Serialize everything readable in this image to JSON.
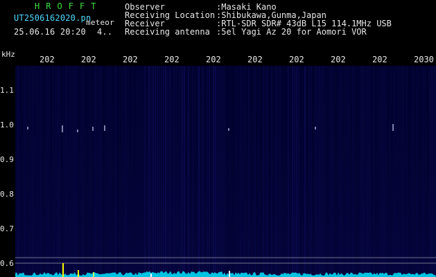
{
  "app": {
    "title": "HROFFT",
    "file_name": "UT2506162020.pn",
    "meteor_label": "meteor",
    "datetime": "25.06.16 20:20",
    "count": "4.."
  },
  "info": [
    {
      "key": "Observer",
      "value": ":Masaki Kano"
    },
    {
      "key": "Receiving Location",
      "value": ":Shibukawa,Gunma,Japan"
    },
    {
      "key": "Receiver",
      "value": ":RTL-SDR SDR# 43dB L15 114.1MHz USB"
    },
    {
      "key": "Receiving antenna",
      "value": ":5el Yagi Az 20 for Aomori VOR"
    }
  ],
  "axes": {
    "unit": "kHz",
    "y_ticks": [
      "1.1",
      "1.0",
      "0.9",
      "0.8",
      "0.7",
      "0.6"
    ],
    "x_ticks": [
      "202",
      "202",
      "202",
      "202",
      "202",
      "202",
      "202",
      "202",
      "202",
      "2030"
    ]
  },
  "colors": {
    "background": "#000000",
    "title": "#3ee03e",
    "file_name": "#4fd8ff",
    "text": "#e8e8e8",
    "noise_floor": "#03033a",
    "signal": "#00e5ff",
    "peak": "#ffff00"
  }
}
